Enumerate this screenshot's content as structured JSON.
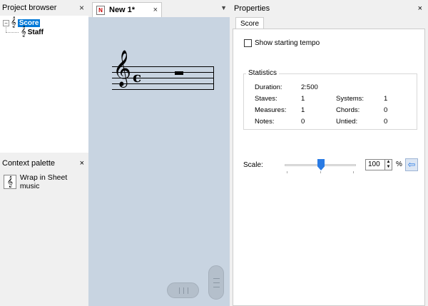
{
  "project_browser": {
    "title": "Project browser",
    "close": "×",
    "tree": {
      "expander": "⊟",
      "root_label": "Score",
      "child_label": "Staff",
      "score_icon": "music-score-icon",
      "staff_icon": "music-staff-icon"
    }
  },
  "context_palette": {
    "title": "Context palette",
    "close": "×",
    "item_label": "Wrap in Sheet music",
    "item_icon": "sheet-music-icon"
  },
  "document": {
    "tab_label": "New 1*",
    "tab_close": "×",
    "tab_icon_text": "N",
    "tab_menu": "▼",
    "clef": "𝄞",
    "time_signature": "c",
    "canvas_color": "#c8d4e1"
  },
  "properties": {
    "title": "Properties",
    "close": "×",
    "tab_label": "Score",
    "show_tempo_label": "Show starting tempo",
    "show_tempo_checked": false,
    "statistics": {
      "title": "Statistics",
      "duration_label": "Duration:",
      "duration_value": "2:500",
      "staves_label": "Staves:",
      "staves_value": "1",
      "systems_label": "Systems:",
      "systems_value": "1",
      "measures_label": "Measures:",
      "measures_value": "1",
      "chords_label": "Chords:",
      "chords_value": "0",
      "notes_label": "Notes:",
      "notes_value": "0",
      "untied_label": "Untied:",
      "untied_value": "0"
    },
    "scale": {
      "label": "Scale:",
      "value": "100",
      "unit": "%",
      "slider_fraction": 0.5,
      "accent": "#2a7be4"
    }
  }
}
